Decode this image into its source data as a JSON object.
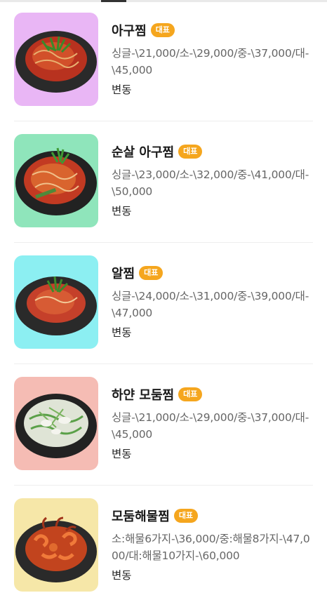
{
  "menu": {
    "items": [
      {
        "name": "아구찜",
        "badge": "대표",
        "price": "싱글-\\21,000/소-\\29,000/중-\\37,000/대-\\45,000",
        "note": "변동",
        "bg_color": "#e9b6f5",
        "food": "red-braised-seafood"
      },
      {
        "name": "순살 아구찜",
        "badge": "대표",
        "price": "싱글-\\23,000/소-\\32,000/중-\\41,000/대-\\50,000",
        "note": "변동",
        "bg_color": "#8fe5bb",
        "food": "red-braised-seafood"
      },
      {
        "name": "알찜",
        "badge": "대표",
        "price": "싱글-\\24,000/소-\\31,000/중-\\39,000/대-\\47,000",
        "note": "변동",
        "bg_color": "#8ceff2",
        "food": "red-braised-seafood"
      },
      {
        "name": "하얀 모둠찜",
        "badge": "대표",
        "price": "싱글-\\21,000/소-\\29,000/중-\\37,000/대-\\45,000",
        "note": "변동",
        "bg_color": "#f5bcb4",
        "food": "white-braised-seafood"
      },
      {
        "name": "모둠해물찜",
        "badge": "대표",
        "price": "소:해물6가지-\\36,000/중:해물8가지-\\47,000/대:해물10가지-\\60,000",
        "note": "변동",
        "bg_color": "#f6e7a8",
        "food": "shrimp-octopus-braise"
      }
    ]
  },
  "colors": {
    "badge": "#f5a61e",
    "divider": "#eeeeee"
  }
}
